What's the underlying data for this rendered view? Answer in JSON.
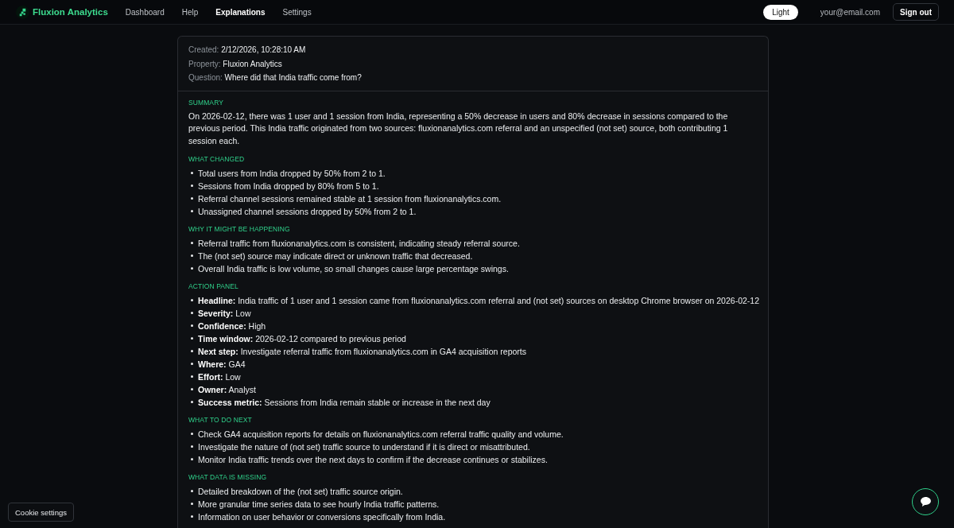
{
  "nav": {
    "brand": "Fluxion Analytics",
    "links": [
      {
        "label": "Dashboard",
        "selected": false
      },
      {
        "label": "Help",
        "selected": false
      },
      {
        "label": "Explanations",
        "selected": true
      },
      {
        "label": "Settings",
        "selected": false
      }
    ],
    "theme_button": "Light",
    "email": "your@email.com",
    "sign_out_button": "Sign out"
  },
  "explanation": {
    "meta": [
      {
        "label": "Created:",
        "value": "2/12/2026, 10:28:10 AM"
      },
      {
        "label": "Property:",
        "value": "Fluxion Analytics"
      },
      {
        "label": "Question:",
        "value": "Where did that India traffic come from?"
      }
    ],
    "sections": [
      {
        "kind": "paragraph",
        "heading": "SUMMARY",
        "text": "On 2026-02-12, there was 1 user and 1 session from India, representing a 50% decrease in users and 80% decrease in sessions compared to the previous period. This India traffic originated from two sources: fluxionanalytics.com referral and an unspecified (not set) source, both contributing 1 session each."
      },
      {
        "kind": "bullets",
        "heading": "WHAT CHANGED",
        "items": [
          "Total users from India dropped by 50% from 2 to 1.",
          "Sessions from India dropped by 80% from 5 to 1.",
          "Referral channel sessions remained stable at 1 session from fluxionanalytics.com.",
          "Unassigned channel sessions dropped by 50% from 2 to 1."
        ]
      },
      {
        "kind": "bullets",
        "heading": "WHY IT MIGHT BE HAPPENING",
        "items": [
          "Referral traffic from fluxionanalytics.com is consistent, indicating steady referral source.",
          "The (not set) source may indicate direct or unknown traffic that decreased.",
          "Overall India traffic is low volume, so small changes cause large percentage swings."
        ]
      },
      {
        "kind": "fields",
        "heading": "ACTION PANEL",
        "items": [
          {
            "label": "Headline:",
            "value": "India traffic of 1 user and 1 session came from fluxionanalytics.com referral and (not set) sources on desktop Chrome browser on 2026-02-12"
          },
          {
            "label": "Severity:",
            "value": "Low"
          },
          {
            "label": "Confidence:",
            "value": "High"
          },
          {
            "label": "Time window:",
            "value": "2026-02-12 compared to previous period"
          },
          {
            "label": "Next step:",
            "value": "Investigate referral traffic from fluxionanalytics.com in GA4 acquisition reports"
          },
          {
            "label": "Where:",
            "value": "GA4"
          },
          {
            "label": "Effort:",
            "value": "Low"
          },
          {
            "label": "Owner:",
            "value": "Analyst"
          },
          {
            "label": "Success metric:",
            "value": "Sessions from India remain stable or increase in the next day"
          }
        ]
      },
      {
        "kind": "bullets",
        "heading": "WHAT TO DO NEXT",
        "items": [
          "Check GA4 acquisition reports for details on fluxionanalytics.com referral traffic quality and volume.",
          "Investigate the nature of (not set) traffic source to understand if it is direct or misattributed.",
          "Monitor India traffic trends over the next days to confirm if the decrease continues or stabilizes."
        ]
      },
      {
        "kind": "bullets",
        "heading": "WHAT DATA IS MISSING",
        "items": [
          "Detailed breakdown of the (not set) traffic source origin.",
          "More granular time series data to see hourly India traffic patterns.",
          "Information on user behavior or conversions specifically from India."
        ]
      }
    ]
  },
  "cookie_button": "Cookie settings"
}
